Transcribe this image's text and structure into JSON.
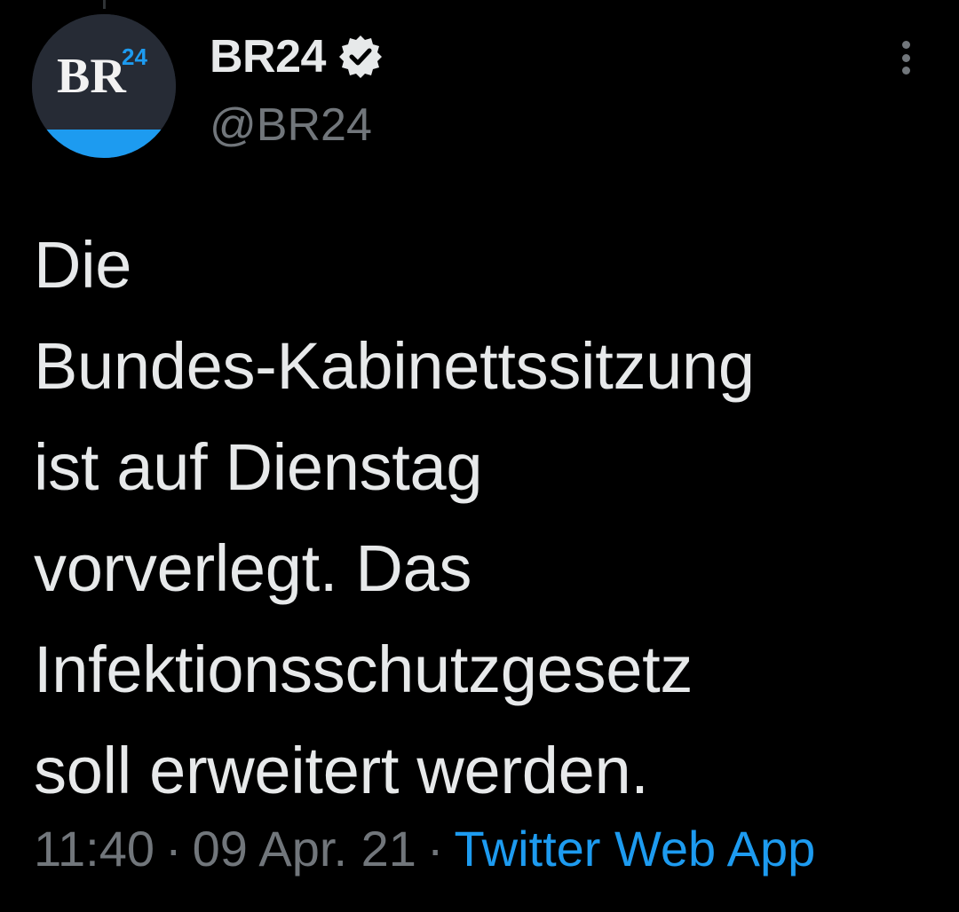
{
  "author": {
    "avatar_text": "BR",
    "avatar_superscript": "24",
    "display_name": "BR24",
    "handle": "@BR24",
    "verified": true,
    "avatar_bg": "#262b35",
    "avatar_accent": "#1d9bf0"
  },
  "menu": {
    "icon": "more-vertical-icon"
  },
  "tweet": {
    "lines": [
      "Die",
      "Bundes-Kabinettssitzung",
      "ist auf Dienstag",
      "vorverlegt. Das",
      "Infektionsschutzgesetz",
      "soll erweitert werden."
    ],
    "time": "11:40",
    "separator": "·",
    "date": "09 Apr. 21",
    "source": "Twitter Web App"
  },
  "colors": {
    "background": "#000000",
    "text": "#e7e9ea",
    "muted": "#71767b",
    "link": "#1d9bf0"
  }
}
